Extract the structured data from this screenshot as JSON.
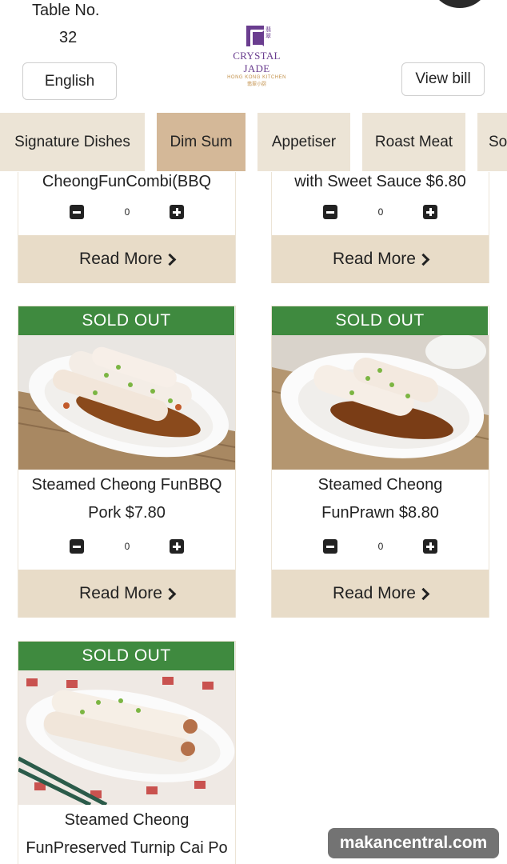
{
  "header": {
    "table_label": "Table No.",
    "table_number": "32",
    "language_button": "English",
    "view_bill_button": "View bill",
    "logo": {
      "name": "CRYSTAL JADE",
      "subtitle": "HONG KONG KITCHEN",
      "brand_color": "#6a3d8f",
      "accent_color": "#c2904a"
    }
  },
  "tabs": [
    {
      "label": "Signature Dishes",
      "active": false
    },
    {
      "label": "Dim Sum",
      "active": true
    },
    {
      "label": "Appetiser",
      "active": false
    },
    {
      "label": "Roast Meat",
      "active": false
    },
    {
      "label": "So",
      "active": false
    }
  ],
  "colors": {
    "sold_out_bg": "#3f8a3f",
    "read_more_bg": "#e8dcc8",
    "tab_bg": "#ece4d6",
    "tab_active_bg": "#d4b898"
  },
  "items": [
    {
      "name_partial": "CheongFunCombi(BBQ",
      "quantity": "0",
      "read_more": "Read More"
    },
    {
      "name_partial": "with Sweet Sauce $6.80",
      "quantity": "0",
      "read_more": "Read More"
    },
    {
      "badge": "SOLD OUT",
      "name_line1": "Steamed Cheong FunBBQ",
      "name_line2": "Pork $7.80",
      "quantity": "0",
      "read_more": "Read More"
    },
    {
      "badge": "SOLD OUT",
      "name_line1": "Steamed Cheong",
      "name_line2": "FunPrawn $8.80",
      "quantity": "0",
      "read_more": "Read More"
    },
    {
      "badge": "SOLD OUT",
      "name_line1": "Steamed Cheong",
      "name_line2": "FunPreserved Turnip Cai Po",
      "quantity": "0",
      "read_more": "Read More"
    }
  ],
  "watermark": "makancentral.com"
}
